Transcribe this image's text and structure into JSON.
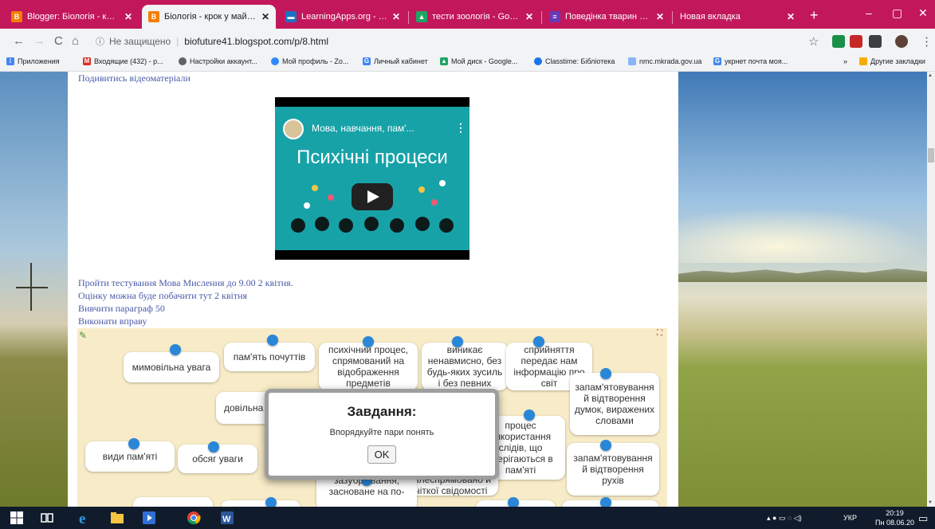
{
  "browser": {
    "tabs": [
      {
        "title": "Blogger: Біологія - крок у м",
        "favicon": "blogger-icon",
        "color": "#f57d00"
      },
      {
        "title": "Біологія - крок у майбутнє",
        "favicon": "blogger-icon",
        "color": "#f57d00",
        "active": true
      },
      {
        "title": "LearningApps.org - создание",
        "favicon": "learningapps-icon",
        "color": "#1a73c6"
      },
      {
        "title": "тести зоологія - Google Ди",
        "favicon": "google-drive-icon",
        "color": "#1fa463"
      },
      {
        "title": "Поведінка тварин узагальн",
        "favicon": "google-forms-icon",
        "color": "#673ab7"
      },
      {
        "title": "Новая вкладка",
        "favicon": "",
        "color": ""
      }
    ],
    "new_tab": "+",
    "window_controls": {
      "minimize": "‒",
      "maximize": "▢",
      "close": "✕"
    }
  },
  "toolbar": {
    "back": "←",
    "forward": "→",
    "reload": "C",
    "home": "⌂",
    "insecure_label": "Не защищено",
    "url": "biofuture41.blogspot.com/p/8.html",
    "star": "☆",
    "menu": "⋮"
  },
  "bookmarks": {
    "items": [
      {
        "label": "Приложения",
        "icon": "apps-grid-icon",
        "color": "#4285f4"
      },
      {
        "label": "Входящие (432) - р...",
        "icon": "gmail-icon",
        "color": "#d93025"
      },
      {
        "label": "Настройки аккаунт...",
        "icon": "settings-icon",
        "color": "#5f6368"
      },
      {
        "label": "Мой профиль - Zo...",
        "icon": "zoom-icon",
        "color": "#2d8cff"
      },
      {
        "label": "Личный кабинет",
        "icon": "google-icon",
        "color": "#4285f4"
      },
      {
        "label": "Мой диск - Google...",
        "icon": "google-drive-icon",
        "color": "#1fa463"
      },
      {
        "label": "Classtime: Бібліотека",
        "icon": "classtime-icon",
        "color": "#1a73e8"
      },
      {
        "label": "nmc.mkrada.gov.ua",
        "icon": "site-icon",
        "color": "#8ab4f8"
      },
      {
        "label": "укрнет почта моя...",
        "icon": "google-icon",
        "color": "#4285f4"
      }
    ],
    "overflow": "»",
    "other": "Другие закладки"
  },
  "page": {
    "link_top": "Подивитись відеоматеріали",
    "video": {
      "title": "Мова, навчання, пам'...",
      "big_text": "Психічні процеси",
      "menu": "⋮"
    },
    "links": [
      "Пройти тестування Мова Мислення до 9.00 2 квітня.",
      "Оцінку можна буде побачити тут 2 квітня",
      "Вивчити параграф 50",
      "Виконати вправу"
    ]
  },
  "app": {
    "corner_left": "✎",
    "corner_right": "⛶",
    "cards": [
      {
        "text": "мимовільна увага"
      },
      {
        "text": "пам'ять почуттів"
      },
      {
        "text": "психічний процес, спрямований на відображення предметів"
      },
      {
        "text": "виникає ненавмисно, без будь-яких зусиль і без певних"
      },
      {
        "text": "сприйняття передає нам інформацію про світ"
      },
      {
        "text": "запам'ятовування й відтворення думок, виражених словами"
      },
      {
        "text": "довільна"
      },
      {
        "text": "процес використання слідів, що зберігаються в пам'яті"
      },
      {
        "text": "види пам'яті"
      },
      {
        "text": "обсяг уваги"
      },
      {
        "text": "вибірково, цілеспрямовано й чіткої свідомості"
      },
      {
        "text": "запам'ятовування й відтворення рухів"
      },
      {
        "text": "зазубрювання, засноване на по-"
      },
      {
        "text": ""
      },
      {
        "text": ""
      },
      {
        "text": ""
      },
      {
        "text": ""
      }
    ],
    "modal": {
      "title": "Завдання:",
      "body": "Впорядкуйте пари понять",
      "ok": "OK"
    }
  },
  "taskbar": {
    "tray": "УКР",
    "time": "20:19",
    "date": "Пн 08.06.20"
  }
}
